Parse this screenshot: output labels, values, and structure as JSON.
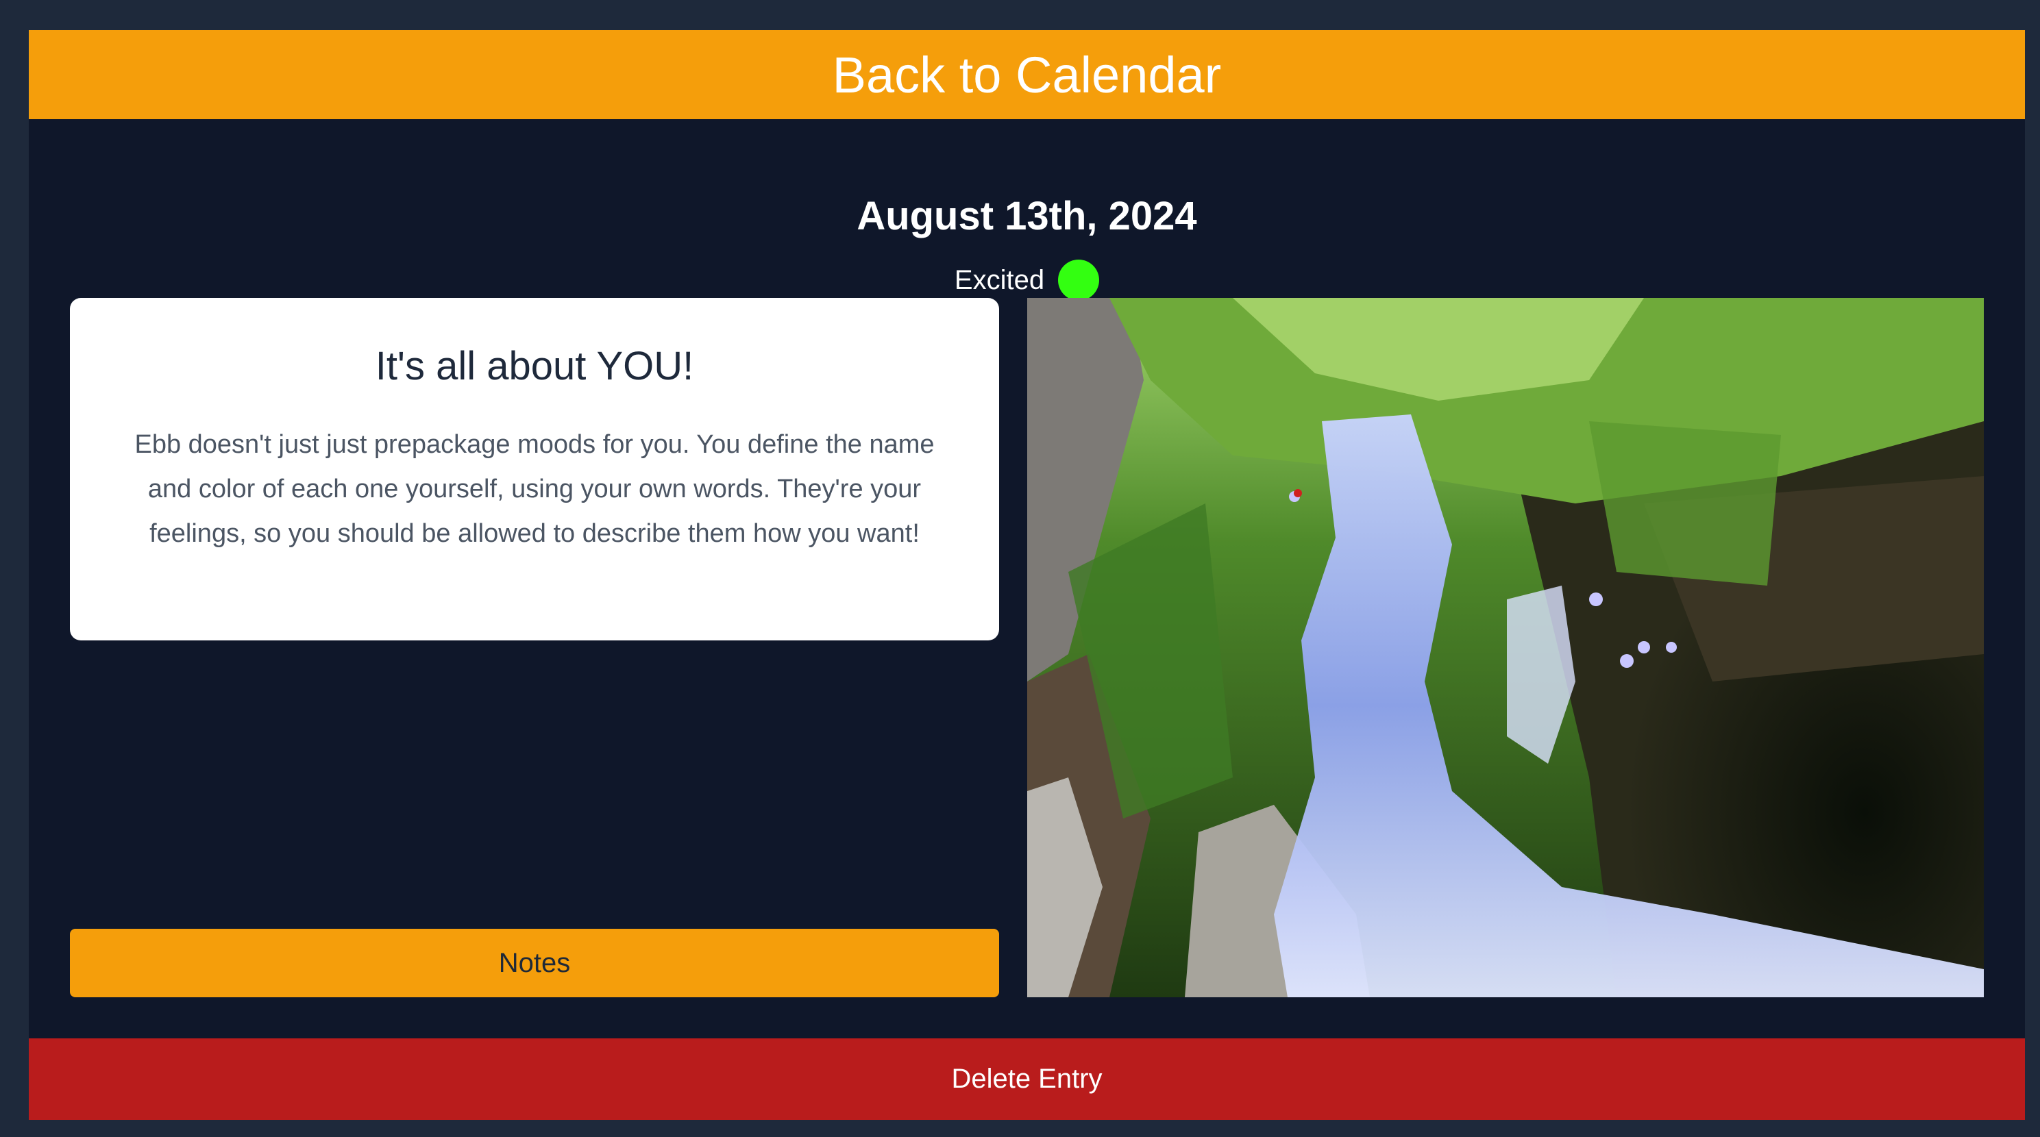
{
  "header": {
    "back_label": "Back to Calendar"
  },
  "entry": {
    "date": "August 13th, 2024",
    "mood_label": "Excited",
    "mood_color": "#33ff11"
  },
  "info_card": {
    "title": "It's all about YOU!",
    "body": "Ebb doesn't just just prepackage moods for you. You define the name and color of each one yourself, using your own words. They're your feelings, so you should be allowed to describe them how you want!"
  },
  "notes_button": {
    "label": "Notes"
  },
  "photo": {
    "subject": "waterfall-photo"
  },
  "delete_button": {
    "label": "Delete Entry"
  },
  "colors": {
    "page_bg": "#1e293b",
    "panel_bg": "#0f172a",
    "accent": "#f59e0b",
    "danger": "#b91c1c"
  }
}
